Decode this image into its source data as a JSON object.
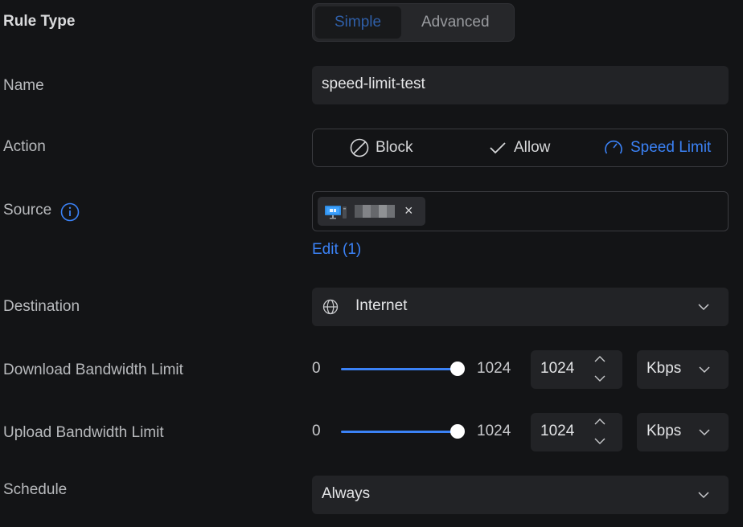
{
  "rule_type": {
    "label": "Rule Type",
    "options": [
      "Simple",
      "Advanced"
    ],
    "selected": "Simple"
  },
  "name": {
    "label": "Name",
    "value": "speed-limit-test"
  },
  "action": {
    "label": "Action",
    "options": [
      {
        "label": "Block",
        "icon": "block-icon"
      },
      {
        "label": "Allow",
        "icon": "check-icon"
      },
      {
        "label": "Speed Limit",
        "icon": "speed-gauge-icon"
      }
    ],
    "selected": "Speed Limit"
  },
  "source": {
    "label": "Source",
    "info_icon": "info-icon",
    "chip_icon": "computer-icon",
    "remove_glyph": "×",
    "edit_link": "Edit (1)"
  },
  "destination": {
    "label": "Destination",
    "icon": "globe-icon",
    "value": "Internet"
  },
  "download": {
    "label": "Download Bandwidth Limit",
    "min": "0",
    "max": "1024",
    "value": "1024",
    "unit": "Kbps"
  },
  "upload": {
    "label": "Upload Bandwidth Limit",
    "min": "0",
    "max": "1024",
    "value": "1024",
    "unit": "Kbps"
  },
  "schedule": {
    "label": "Schedule",
    "value": "Always"
  },
  "colors": {
    "accent": "#3b82f6",
    "background": "#131416",
    "field": "#222326"
  }
}
